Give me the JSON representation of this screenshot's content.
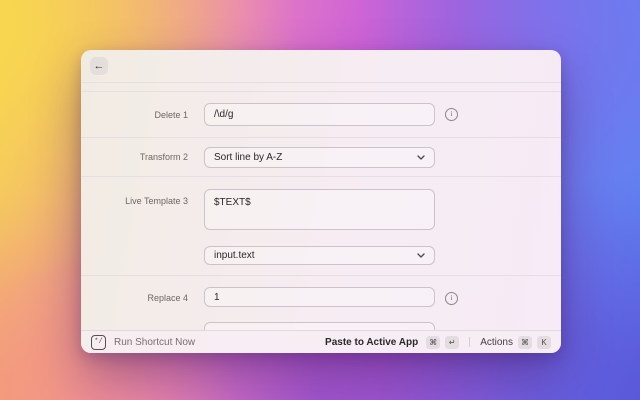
{
  "window": {
    "header": {
      "back_icon": "←"
    },
    "form": {
      "rows": [
        {
          "label": "Delete 1",
          "value": "/\\d/g"
        },
        {
          "label": "Transform 2",
          "value": "Sort line by A-Z"
        },
        {
          "label": "Live Template 3",
          "value": "$TEXT$"
        },
        {
          "label": "",
          "value": "input.text"
        },
        {
          "label": "Replace 4",
          "value": "1"
        }
      ]
    },
    "footer": {
      "app_icon_glyph": "*/",
      "run_label": "Run Shortcut Now",
      "primary_label": "Paste to Active App",
      "primary_keys": [
        "⌘",
        "↵"
      ],
      "actions_label": "Actions",
      "actions_keys": [
        "⌘",
        "K"
      ]
    }
  },
  "icons": {
    "info": "i"
  },
  "colors": {
    "bg_yellow": "#f6d054",
    "bg_pink": "#e77fc0",
    "bg_purple": "#b25ad8",
    "bg_blue": "#5f7df0",
    "window_tint": "#f6ecf3"
  }
}
